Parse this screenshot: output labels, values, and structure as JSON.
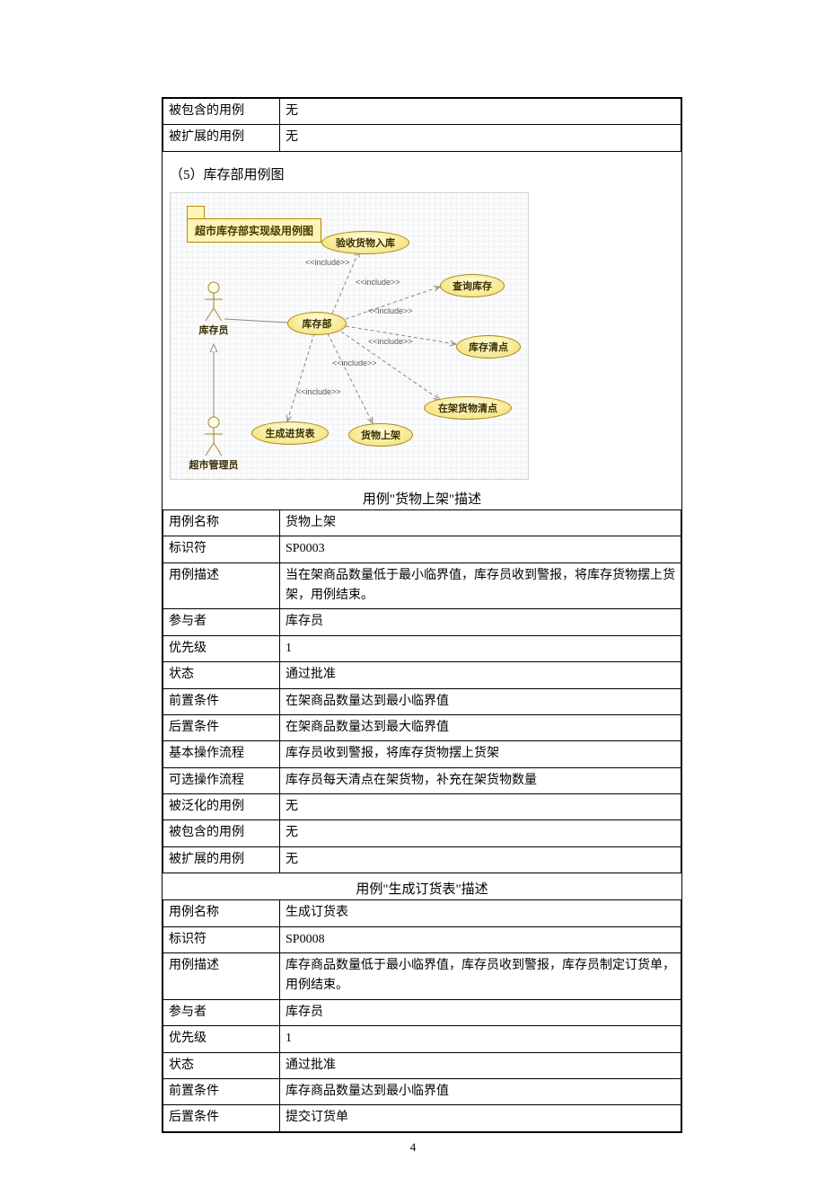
{
  "topTable": {
    "rows": [
      {
        "k": "被包含的用例",
        "v": "无"
      },
      {
        "k": "被扩展的用例",
        "v": "无"
      }
    ]
  },
  "section5": {
    "title": "（5）库存部用例图"
  },
  "diagram": {
    "package_title": "超市库存部实现级用例图",
    "actors": {
      "warehouse_staff": "库存员",
      "market_admin": "超市管理员"
    },
    "usecases": {
      "inventory_dept": "库存部",
      "inspect_goods_in": "验收货物入库",
      "query_stock": "查询库存",
      "stock_count": "库存清点",
      "shelf_goods_count": "在架货物清点",
      "goods_onshelf": "货物上架",
      "gen_purchase_form": "生成进货表"
    },
    "include_label": "<<include>>"
  },
  "caption1": "用例\"货物上架\"描述",
  "table1": {
    "rows": [
      {
        "k": "用例名称",
        "v": "货物上架"
      },
      {
        "k": "标识符",
        "v": "SP0003"
      },
      {
        "k": "用例描述",
        "v": "当在架商品数量低于最小临界值，库存员收到警报，将库存货物摆上货架，用例结束。"
      },
      {
        "k": "参与者",
        "v": "库存员"
      },
      {
        "k": "优先级",
        "v": "1"
      },
      {
        "k": "状态",
        "v": "通过批准"
      },
      {
        "k": "前置条件",
        "v": "在架商品数量达到最小临界值"
      },
      {
        "k": "后置条件",
        "v": "在架商品数量达到最大临界值"
      },
      {
        "k": "基本操作流程",
        "v": "库存员收到警报，将库存货物摆上货架"
      },
      {
        "k": "可选操作流程",
        "v": "库存员每天清点在架货物，补充在架货物数量"
      },
      {
        "k": "被泛化的用例",
        "v": "无"
      },
      {
        "k": "被包含的用例",
        "v": "无"
      },
      {
        "k": "被扩展的用例",
        "v": "无"
      }
    ]
  },
  "caption2": "用例\"生成订货表\"描述",
  "table2": {
    "rows": [
      {
        "k": "用例名称",
        "v": "生成订货表"
      },
      {
        "k": "标识符",
        "v": "SP0008"
      },
      {
        "k": "用例描述",
        "v": "库存商品数量低于最小临界值，库存员收到警报，库存员制定订货单，用例结束。"
      },
      {
        "k": "参与者",
        "v": "库存员"
      },
      {
        "k": "优先级",
        "v": "1"
      },
      {
        "k": "状态",
        "v": "通过批准"
      },
      {
        "k": "前置条件",
        "v": "库存商品数量达到最小临界值"
      },
      {
        "k": "后置条件",
        "v": "提交订货单"
      }
    ]
  },
  "pageNumber": "4"
}
